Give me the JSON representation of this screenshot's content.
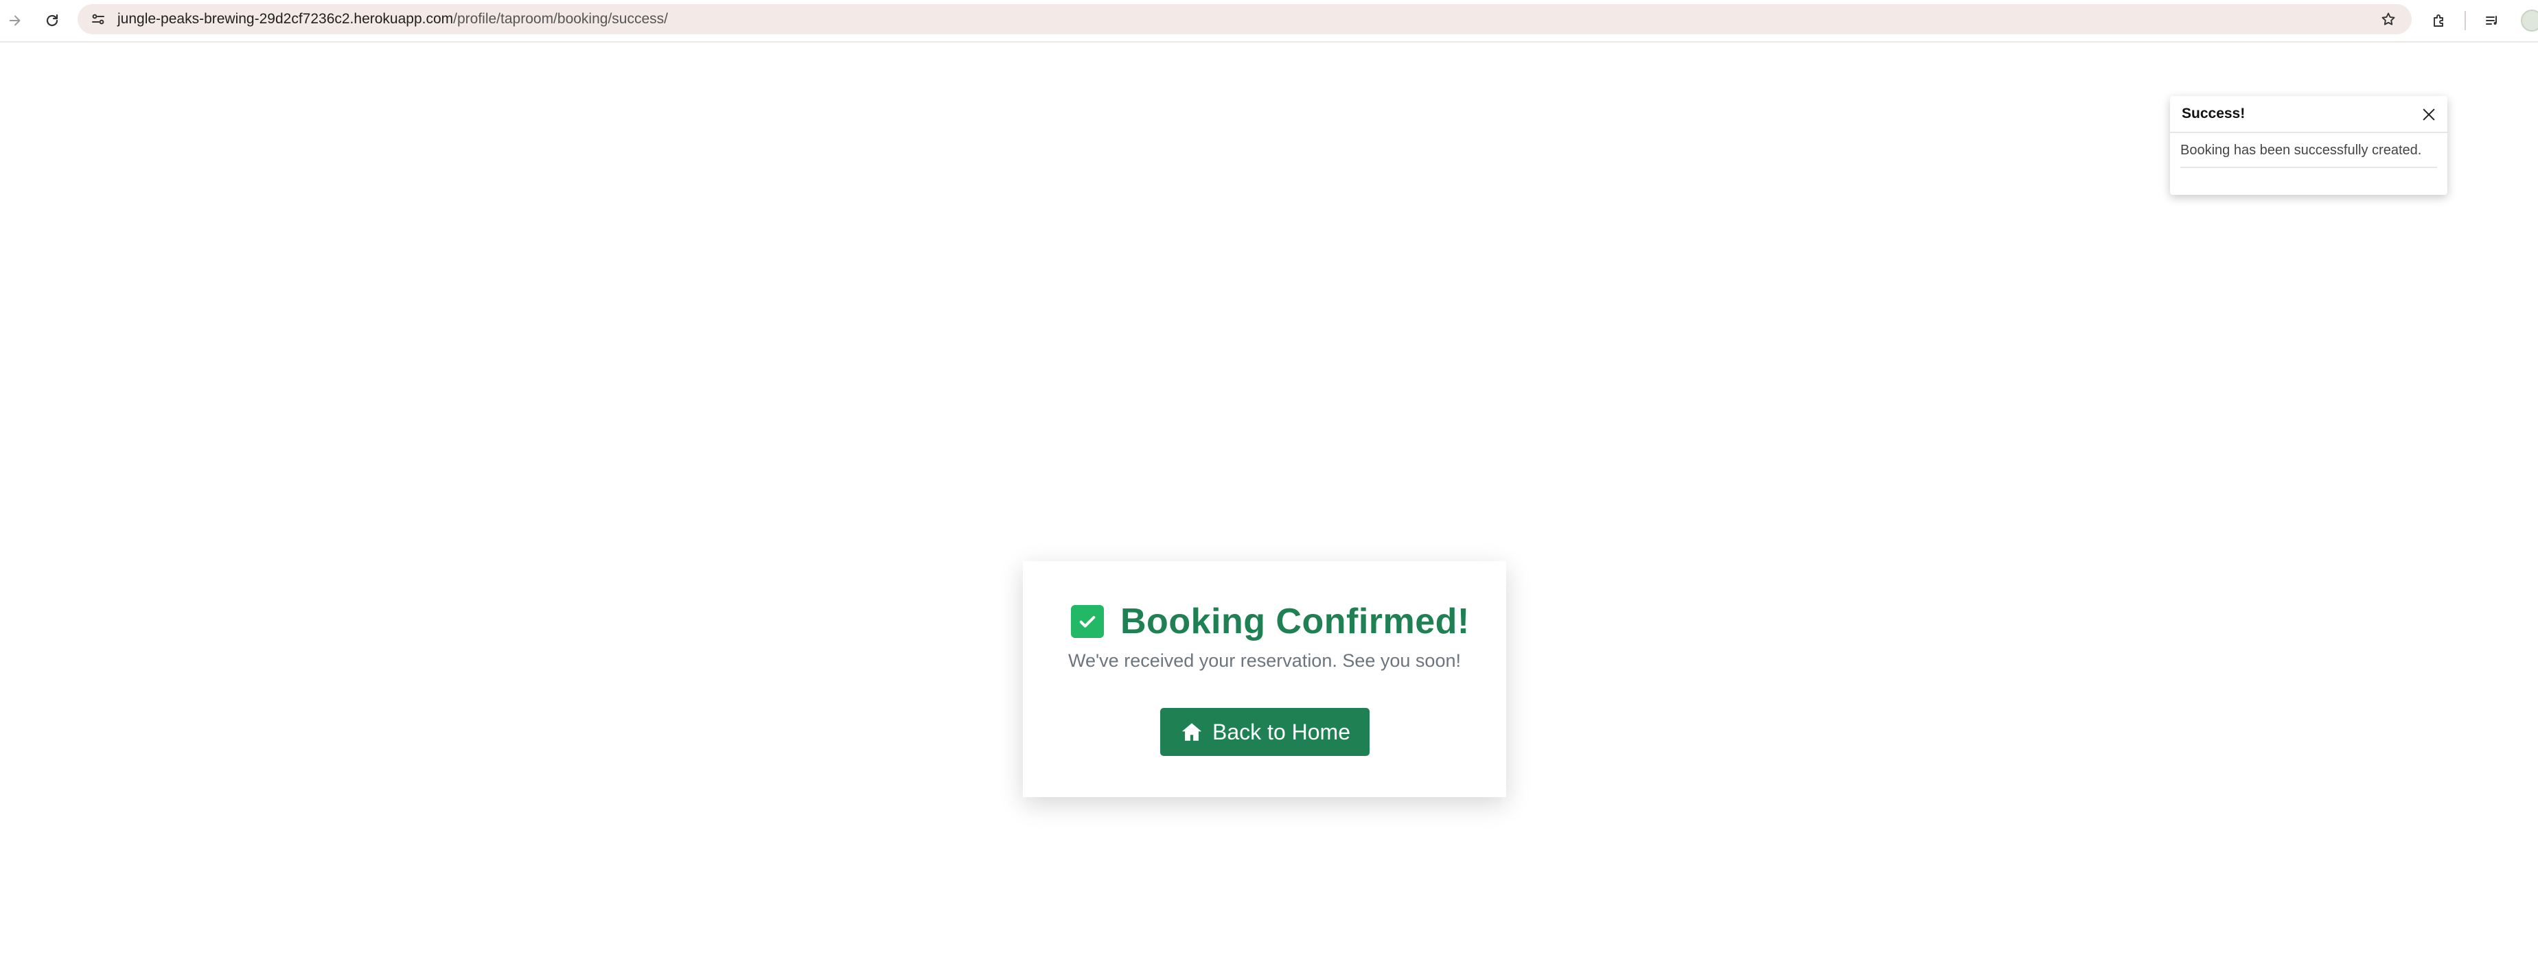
{
  "browser": {
    "url_host": "jungle-peaks-brewing-29d2cf7236c2.herokuapp.com",
    "url_path": "/profile/taproom/booking/success/",
    "icons": [
      "forward-icon",
      "reload-icon",
      "site-info-icon",
      "bookmark-star-icon",
      "extensions-icon",
      "media-controls-icon",
      "profile-avatar"
    ]
  },
  "toast": {
    "title": "Success!",
    "message": "Booking has been successfully created.",
    "close_icon": "close-icon"
  },
  "confirmation": {
    "title": "Booking Confirmed!",
    "subtitle": "We've received your reservation. See you soon!",
    "button_label": "Back to Home",
    "check_icon": "check-square-icon",
    "button_icon": "home-icon"
  },
  "colors": {
    "brand_green": "#1e8053",
    "check_green": "#22b865",
    "muted_text": "#6c757d",
    "omnibox_bg": "#f3e9e6"
  }
}
